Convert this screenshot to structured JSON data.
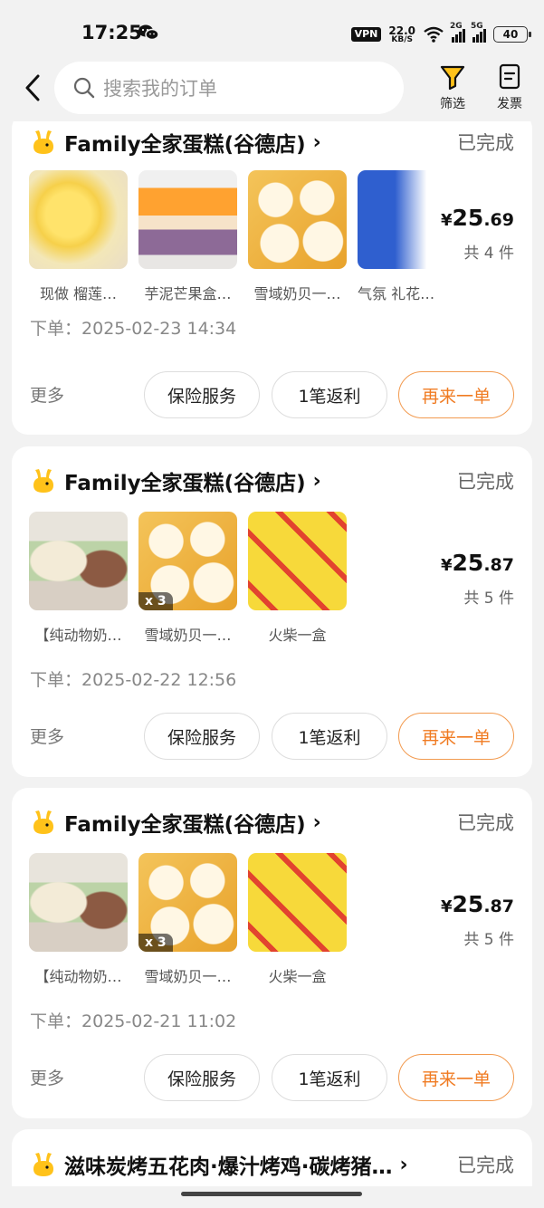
{
  "status_bar": {
    "time": "17:25",
    "vpn": "VPN",
    "net_speed_value": "22.0",
    "net_speed_unit": "KB/S",
    "sim1": "2G",
    "sim2": "5G",
    "battery": "40"
  },
  "header": {
    "search_placeholder": "搜索我的订单",
    "filter_label": "筛选",
    "invoice_label": "发票"
  },
  "orders": [
    {
      "shop": "Family全家蛋糕(谷德店)",
      "status": "已完成",
      "items": [
        {
          "label": "现做 榴莲…",
          "qty": ""
        },
        {
          "label": "芋泥芒果盒…",
          "qty": ""
        },
        {
          "label": "雪域奶贝一…",
          "qty": ""
        },
        {
          "label": "气氛 礼花…",
          "qty": ""
        }
      ],
      "price_symbol": "¥",
      "price_int": "25",
      "price_dec": ".69",
      "count": "共 4 件",
      "time_label": "下单：",
      "time": "2025-02-23 14:34",
      "more": "更多",
      "btn_insurance": "保险服务",
      "btn_rebate": "1笔返利",
      "btn_reorder": "再来一单"
    },
    {
      "shop": "Family全家蛋糕(谷德店)",
      "status": "已完成",
      "items": [
        {
          "label": "【纯动物奶…",
          "qty": ""
        },
        {
          "label": "雪域奶贝一…",
          "qty": "x 3"
        },
        {
          "label": "火柴一盒",
          "qty": ""
        }
      ],
      "price_symbol": "¥",
      "price_int": "25",
      "price_dec": ".87",
      "count": "共 5 件",
      "time_label": "下单：",
      "time": "2025-02-22 12:56",
      "more": "更多",
      "btn_insurance": "保险服务",
      "btn_rebate": "1笔返利",
      "btn_reorder": "再来一单"
    },
    {
      "shop": "Family全家蛋糕(谷德店)",
      "status": "已完成",
      "items": [
        {
          "label": "【纯动物奶…",
          "qty": ""
        },
        {
          "label": "雪域奶贝一…",
          "qty": "x 3"
        },
        {
          "label": "火柴一盒",
          "qty": ""
        }
      ],
      "price_symbol": "¥",
      "price_int": "25",
      "price_dec": ".87",
      "count": "共 5 件",
      "time_label": "下单：",
      "time": "2025-02-21 11:02",
      "more": "更多",
      "btn_insurance": "保险服务",
      "btn_rebate": "1笔返利",
      "btn_reorder": "再来一单"
    },
    {
      "shop": "滋味炭烤五花肉·爆汁烤鸡·碳烤猪…",
      "status": "已完成"
    }
  ],
  "colors": {
    "background": "#f2f2f2",
    "accent": "#f07b22",
    "logo_yellow": "#ffc21a"
  }
}
